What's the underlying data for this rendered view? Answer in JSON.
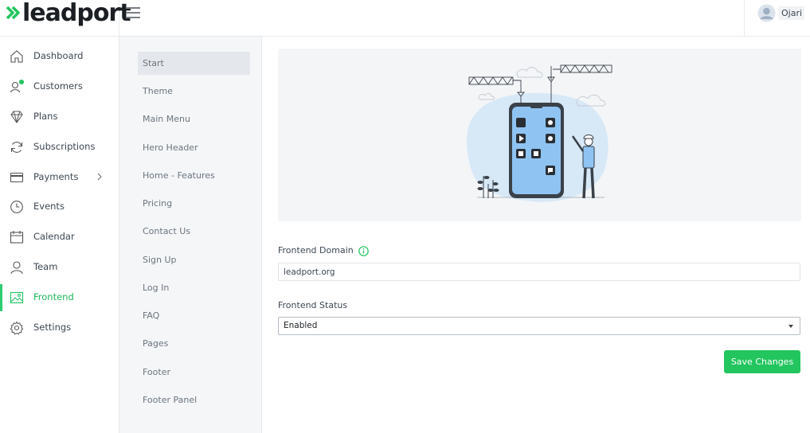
{
  "brand": {
    "name": "leadport",
    "accent": "#22c55e"
  },
  "user": {
    "name": "Ojari"
  },
  "sidebar": {
    "items": [
      {
        "label": "Dashboard",
        "icon": "home-icon"
      },
      {
        "label": "Customers",
        "icon": "users-icon"
      },
      {
        "label": "Plans",
        "icon": "diamond-icon"
      },
      {
        "label": "Subscriptions",
        "icon": "refresh-icon"
      },
      {
        "label": "Payments",
        "icon": "credit-card-icon"
      },
      {
        "label": "Events",
        "icon": "clock-icon"
      },
      {
        "label": "Calendar",
        "icon": "calendar-icon"
      },
      {
        "label": "Team",
        "icon": "user-icon"
      },
      {
        "label": "Frontend",
        "icon": "image-icon",
        "active": true
      },
      {
        "label": "Settings",
        "icon": "gear-icon"
      }
    ]
  },
  "submenu": {
    "items": [
      "Start",
      "Theme",
      "Main Menu",
      "Hero Header",
      "Home - Features",
      "Pricing",
      "Contact Us",
      "Sign Up",
      "Log In",
      "FAQ",
      "Pages",
      "Footer",
      "Footer Panel"
    ],
    "active": "Start"
  },
  "form": {
    "domain_label": "Frontend Domain",
    "domain_value": "leadport.org",
    "status_label": "Frontend Status",
    "status_value": "Enabled",
    "save_label": "Save Changes"
  }
}
